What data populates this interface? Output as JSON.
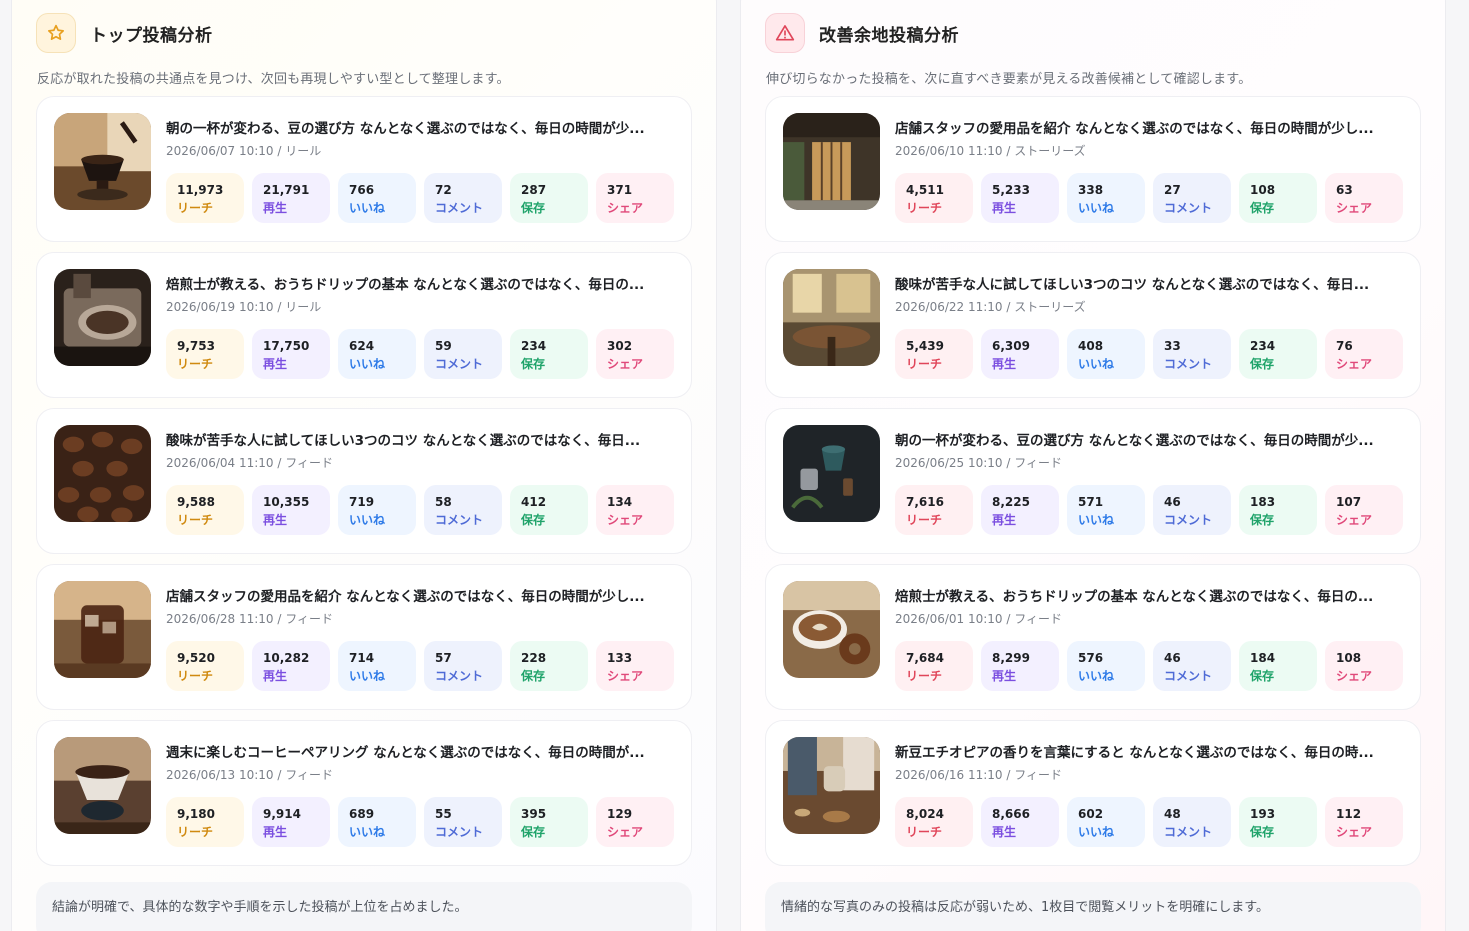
{
  "top_section": {
    "title": "トップ投稿分析",
    "description": "反応が取れた投稿の共通点を見つけ、次回も再現しやすい型として整理します。",
    "summary": "結論が明確で、具体的な数字や手順を示した投稿が上位を占めました。",
    "posts": [
      {
        "title": "朝の一杯が変わる、豆の選び方 なんとなく選ぶのではなく、毎日の時間が少...",
        "meta": "2026/06/07 10:10 / リール",
        "thumb": "pour-over-coffee",
        "metrics": {
          "reach": "11,973",
          "play": "21,791",
          "like": "766",
          "comment": "72",
          "save": "287",
          "share": "371"
        }
      },
      {
        "title": "焙煎士が教える、おうちドリップの基本 なんとなく選ぶのではなく、毎日の...",
        "meta": "2026/06/19 10:10 / リール",
        "thumb": "coffee-roaster",
        "metrics": {
          "reach": "9,753",
          "play": "17,750",
          "like": "624",
          "comment": "59",
          "save": "234",
          "share": "302"
        }
      },
      {
        "title": "酸味が苦手な人に試してほしい3つのコツ なんとなく選ぶのではなく、毎日...",
        "meta": "2026/06/04 11:10 / フィード",
        "thumb": "coffee-beans",
        "metrics": {
          "reach": "9,588",
          "play": "10,355",
          "like": "719",
          "comment": "58",
          "save": "412",
          "share": "134"
        }
      },
      {
        "title": "店舗スタッフの愛用品を紹介 なんとなく選ぶのではなく、毎日の時間が少し...",
        "meta": "2026/06/28 11:10 / フィード",
        "thumb": "iced-coffee",
        "metrics": {
          "reach": "9,520",
          "play": "10,282",
          "like": "714",
          "comment": "57",
          "save": "228",
          "share": "133"
        }
      },
      {
        "title": "週末に楽しむコーヒーペアリング なんとなく選ぶのではなく、毎日の時間が...",
        "meta": "2026/06/13 10:10 / フィード",
        "thumb": "dripper-closeup",
        "metrics": {
          "reach": "9,180",
          "play": "9,914",
          "like": "689",
          "comment": "55",
          "save": "395",
          "share": "129"
        }
      }
    ]
  },
  "improve_section": {
    "title": "改善余地投稿分析",
    "description": "伸び切らなかった投稿を、次に直すべき要素が見える改善候補として確認します。",
    "summary": "情緒的な写真のみの投稿は反応が弱いため、1枚目で閲覧メリットを明確にします。",
    "posts": [
      {
        "title": "店舗スタッフの愛用品を紹介 なんとなく選ぶのではなく、毎日の時間が少し...",
        "meta": "2026/06/10 11:10 / ストーリーズ",
        "thumb": "cafe-storefront",
        "metrics": {
          "reach": "4,511",
          "play": "5,233",
          "like": "338",
          "comment": "27",
          "save": "108",
          "share": "63"
        }
      },
      {
        "title": "酸味が苦手な人に試してほしい3つのコツ なんとなく選ぶのではなく、毎日...",
        "meta": "2026/06/22 11:10 / ストーリーズ",
        "thumb": "cafe-table",
        "metrics": {
          "reach": "5,439",
          "play": "6,309",
          "like": "408",
          "comment": "33",
          "save": "234",
          "share": "76"
        }
      },
      {
        "title": "朝の一杯が変わる、豆の選び方 なんとなく選ぶのではなく、毎日の時間が少...",
        "meta": "2026/06/25 10:10 / フィード",
        "thumb": "brewing-tools",
        "metrics": {
          "reach": "7,616",
          "play": "8,225",
          "like": "571",
          "comment": "46",
          "save": "183",
          "share": "107"
        }
      },
      {
        "title": "焙煎士が教える、おうちドリップの基本 なんとなく選ぶのではなく、毎日の...",
        "meta": "2026/06/01 10:10 / フィード",
        "thumb": "latte-donut",
        "metrics": {
          "reach": "7,684",
          "play": "8,299",
          "like": "576",
          "comment": "46",
          "save": "184",
          "share": "108"
        }
      },
      {
        "title": "新豆エチオピアの香りを言葉にすると なんとなく選ぶのではなく、毎日の時...",
        "meta": "2026/06/16 11:10 / フィード",
        "thumb": "hands-with-cup",
        "metrics": {
          "reach": "8,024",
          "play": "8,666",
          "like": "602",
          "comment": "48",
          "save": "193",
          "share": "112"
        }
      }
    ]
  },
  "metric_labels": {
    "reach": "リーチ",
    "play": "再生",
    "like": "いいね",
    "comment": "コメント",
    "save": "保存",
    "share": "シェア"
  },
  "colors": {
    "top_accent": "#e8a020",
    "improve_accent": "#e0465a"
  }
}
